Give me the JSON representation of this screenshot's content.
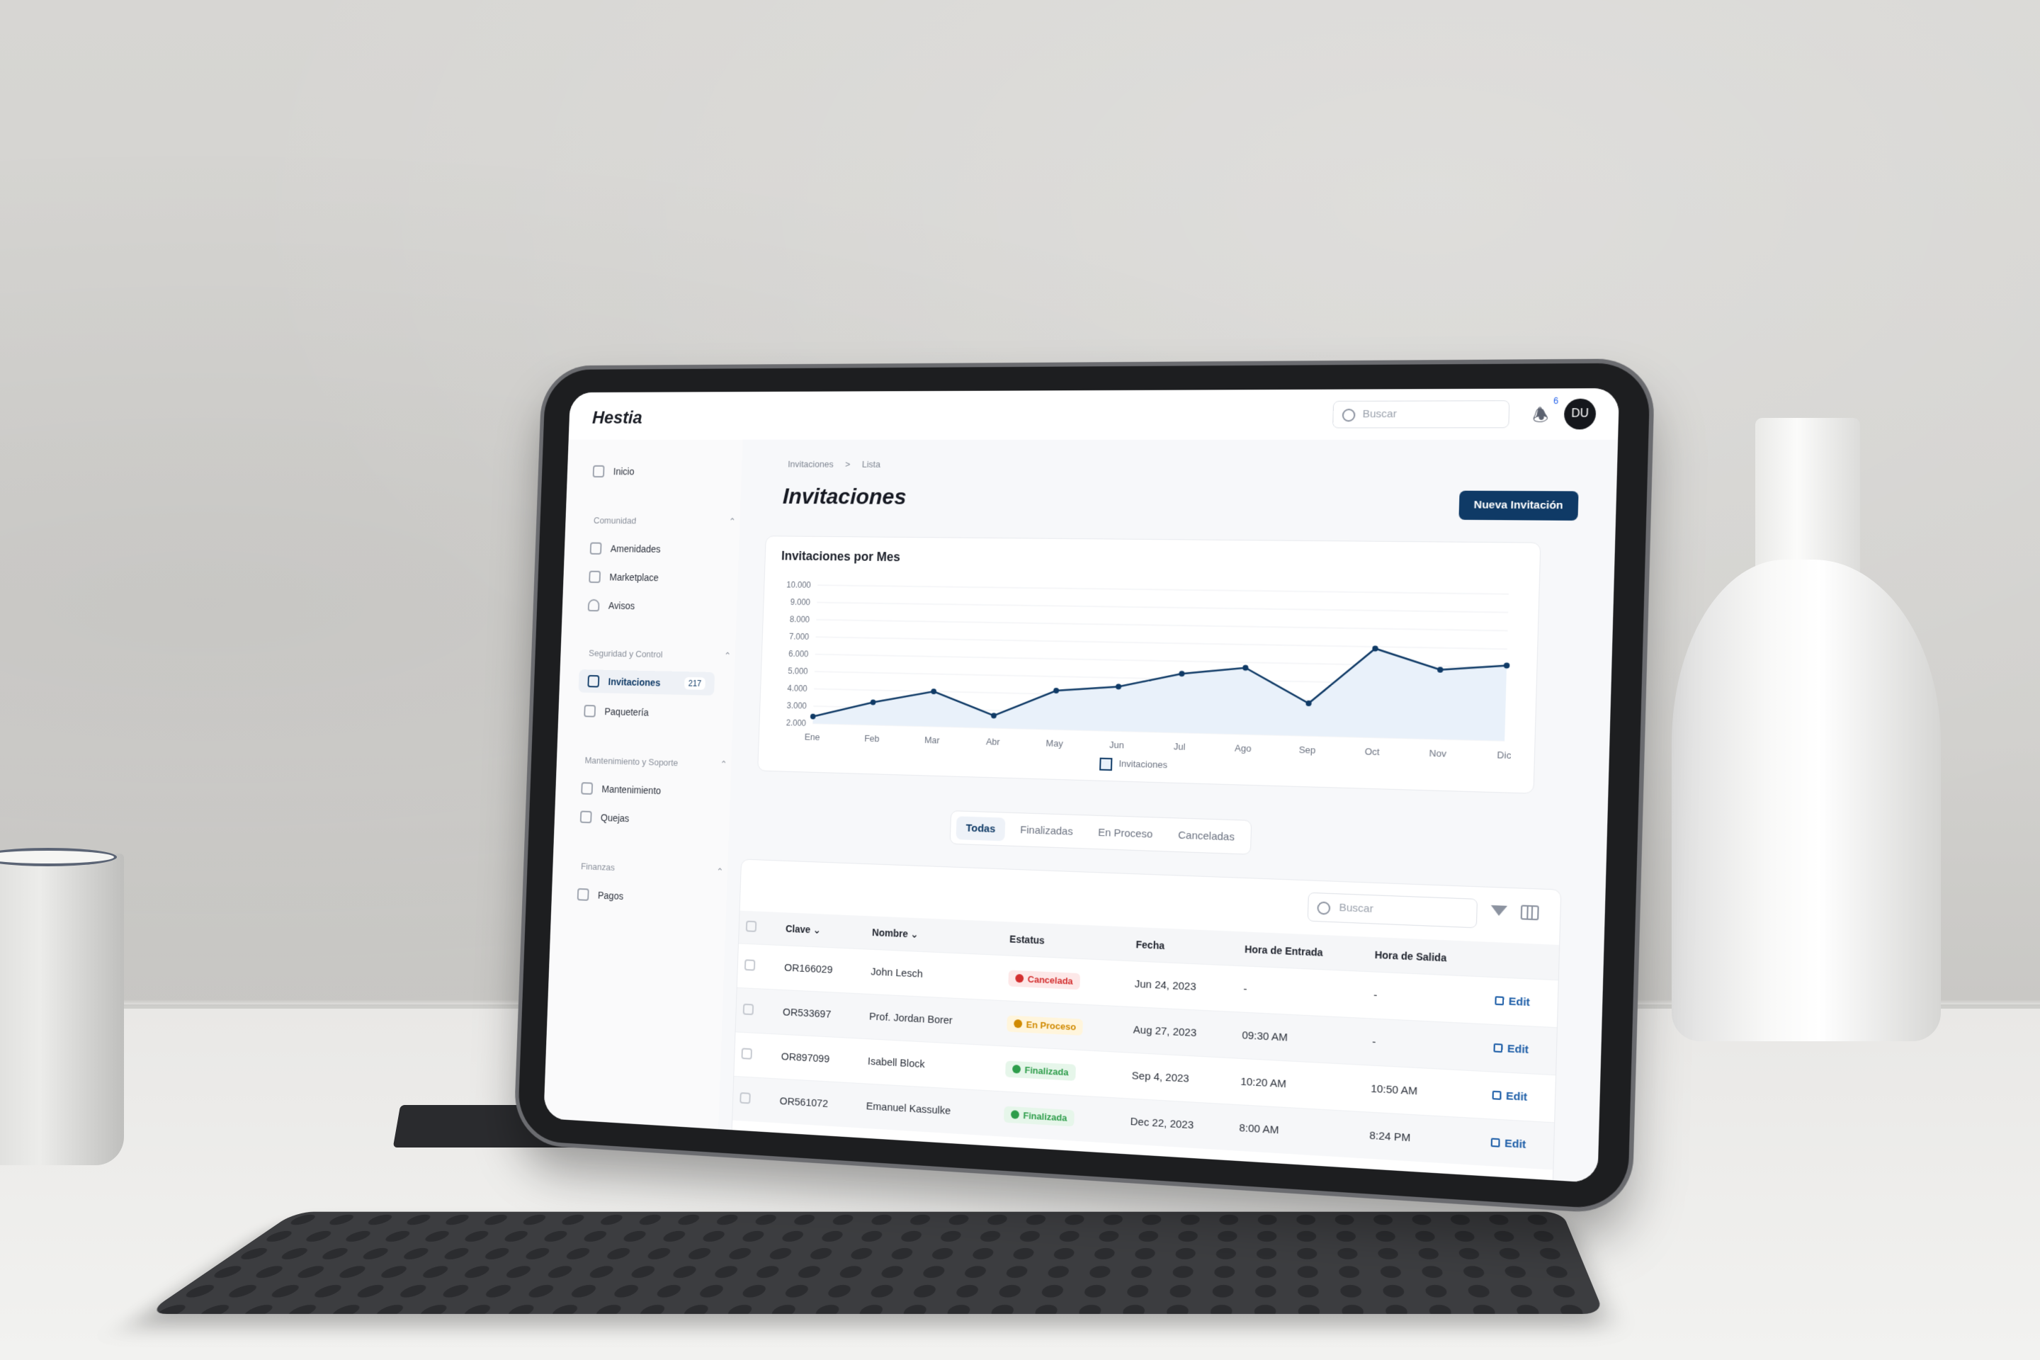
{
  "app": {
    "logo": "Hestia"
  },
  "topbar": {
    "search_placeholder": "Buscar",
    "notification_count": "6",
    "avatar_initials": "DU"
  },
  "sidebar": {
    "home": "Inicio",
    "sections": [
      {
        "title": "Comunidad",
        "items": [
          "Amenidades",
          "Marketplace",
          "Avisos"
        ]
      },
      {
        "title": "Seguridad y Control",
        "items": [
          "Invitaciones",
          "Paquetería"
        ]
      },
      {
        "title": "Mantenimiento y Soporte",
        "items": [
          "Mantenimiento",
          "Quejas"
        ]
      },
      {
        "title": "Finanzas",
        "items": [
          "Pagos"
        ]
      }
    ],
    "active_item": "Invitaciones",
    "active_count": "217"
  },
  "breadcrumb": {
    "parent": "Invitaciones",
    "separator": ">",
    "current": "Lista"
  },
  "page": {
    "title": "Invitaciones",
    "new_button": "Nueva Invitación"
  },
  "chart_data": {
    "type": "area",
    "title": "Invitaciones por Mes",
    "categories": [
      "Ene",
      "Feb",
      "Mar",
      "Abr",
      "May",
      "Jun",
      "Jul",
      "Ago",
      "Sep",
      "Oct",
      "Nov",
      "Dic"
    ],
    "y_ticks": [
      "10.000",
      "9.000",
      "8.000",
      "7.000",
      "6.000",
      "5.000",
      "4.000",
      "3.000",
      "2.000"
    ],
    "ylim": [
      2000,
      10000
    ],
    "series": [
      {
        "name": "Invitaciones",
        "values": [
          2400,
          3300,
          4000,
          2700,
          4200,
          4500,
          5300,
          5700,
          3800,
          6900,
          5800,
          6100
        ]
      }
    ],
    "line_color": "#0f3a66",
    "fill_color": "#e9f1fa",
    "grid": true,
    "legend_position": "bottom"
  },
  "tabs": {
    "items": [
      "Todas",
      "Finalizadas",
      "En Proceso",
      "Canceladas"
    ],
    "active": "Todas"
  },
  "table": {
    "search_placeholder": "Buscar",
    "headers": [
      "Clave",
      "Nombre",
      "Estatus",
      "Fecha",
      "Hora de Entrada",
      "Hora de Salida"
    ],
    "edit_label": "Edit",
    "rows": [
      {
        "clave": "OR166029",
        "nombre": "John Lesch",
        "estatus": "Cancelada",
        "status_kind": "cancel",
        "fecha": "Jun 24, 2023",
        "entrada": "-",
        "salida": "-"
      },
      {
        "clave": "OR533697",
        "nombre": "Prof. Jordan Borer",
        "estatus": "En Proceso",
        "status_kind": "progress",
        "fecha": "Aug 27, 2023",
        "entrada": "09:30 AM",
        "salida": "-"
      },
      {
        "clave": "OR897099",
        "nombre": "Isabell Block",
        "estatus": "Finalizada",
        "status_kind": "done",
        "fecha": "Sep 4, 2023",
        "entrada": "10:20 AM",
        "salida": "10:50 AM"
      },
      {
        "clave": "OR561072",
        "nombre": "Emanuel Kassulke",
        "estatus": "Finalizada",
        "status_kind": "done",
        "fecha": "Dec 22, 2023",
        "entrada": "8:00 AM",
        "salida": "8:24 PM"
      }
    ],
    "status_colors": {
      "cancel": {
        "bg": "#fde8e8",
        "fg": "#d32f2f"
      },
      "progress": {
        "bg": "#fff5dc",
        "fg": "#d08a00"
      },
      "done": {
        "bg": "#e6f6ea",
        "fg": "#2e9d4b"
      }
    }
  }
}
